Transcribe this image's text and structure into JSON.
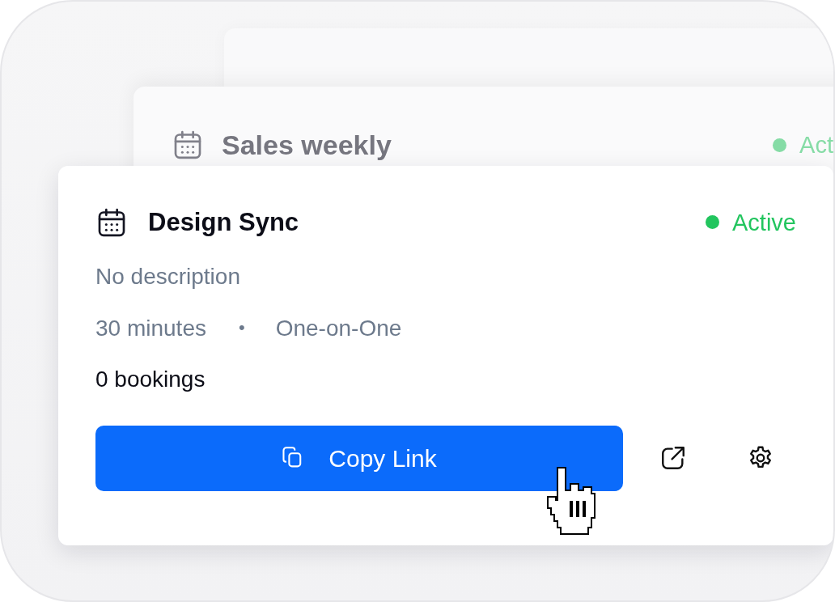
{
  "cards": [
    {
      "title": "Sales weekly",
      "status": "Act",
      "color": "#86dca6"
    },
    {
      "title": "Design Sync",
      "status": "Active",
      "color": "#22c55e",
      "description": "No description",
      "duration": "30 minutes",
      "separator": "•",
      "meeting_type": "One-on-One",
      "bookings": "0 bookings",
      "copy_button": "Copy Link"
    }
  ]
}
